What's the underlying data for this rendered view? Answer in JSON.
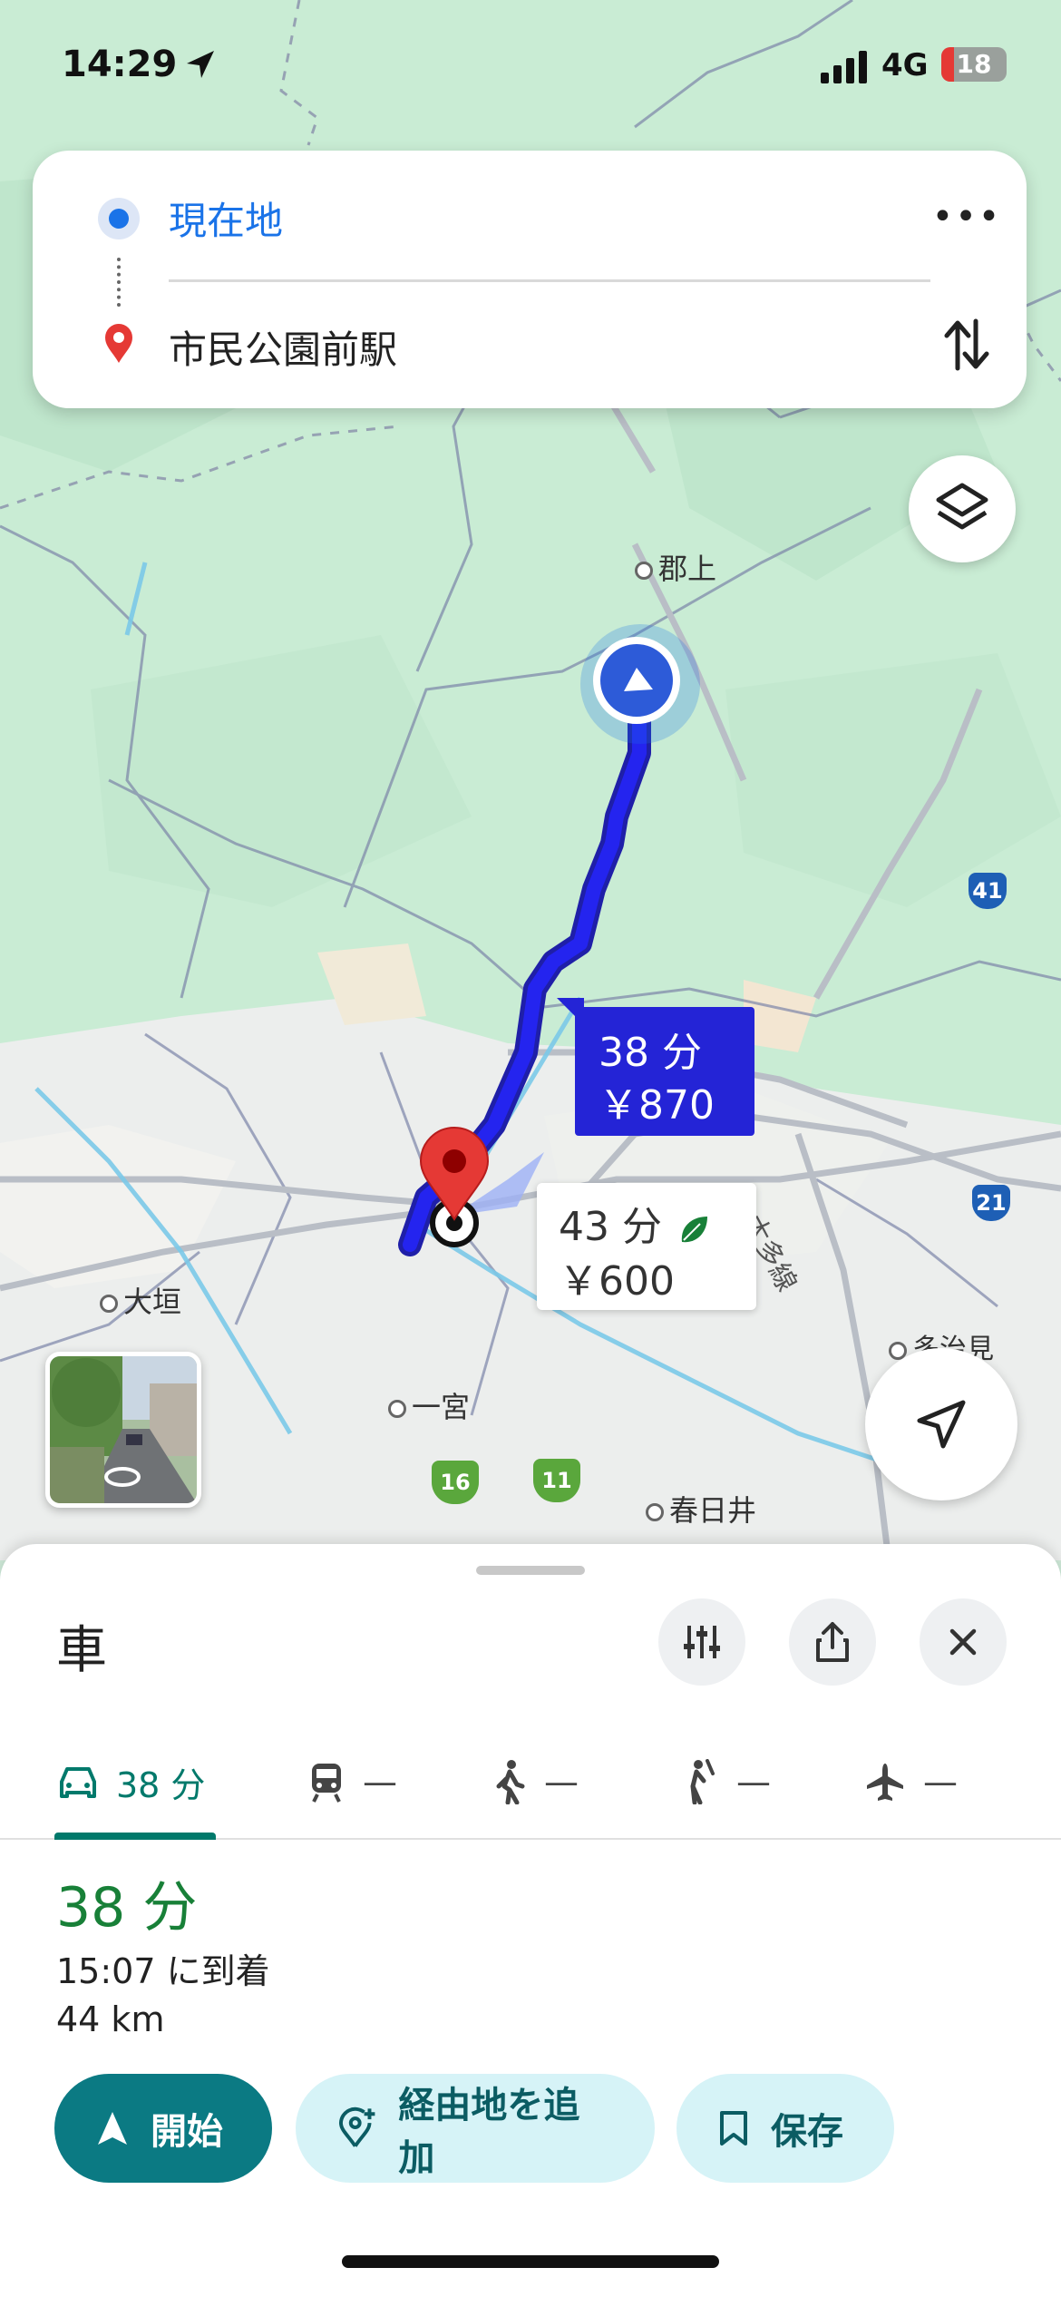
{
  "status_bar": {
    "time": "14:29",
    "network": "4G",
    "battery": "18"
  },
  "route_card": {
    "origin": "現在地",
    "destination": "市民公園前駅",
    "more_label": "•••"
  },
  "map": {
    "place_labels": [
      "郡上",
      "大垣",
      "一宮",
      "春日井",
      "多治見",
      "太多線"
    ],
    "road_badges": [
      "41",
      "21",
      "16",
      "11"
    ],
    "route_primary": {
      "time": "38 分",
      "toll": "￥870"
    },
    "route_alt": {
      "time": "43 分",
      "toll": "￥600"
    }
  },
  "sheet": {
    "mode_title": "車",
    "tabs": [
      {
        "name": "car",
        "label": "38 分",
        "active": true
      },
      {
        "name": "transit",
        "label": "—"
      },
      {
        "name": "walk",
        "label": "—"
      },
      {
        "name": "ride",
        "label": "—"
      },
      {
        "name": "flight",
        "label": "—"
      }
    ],
    "duration": "38 分",
    "arrival": "15:07 に到着",
    "distance": "44 km",
    "buttons": {
      "start": "開始",
      "add_stop": "経由地を追加",
      "save": "保存"
    }
  },
  "colors": {
    "accent": "#0b7a83",
    "route": "#1a1ad4",
    "duration": "#188038"
  }
}
